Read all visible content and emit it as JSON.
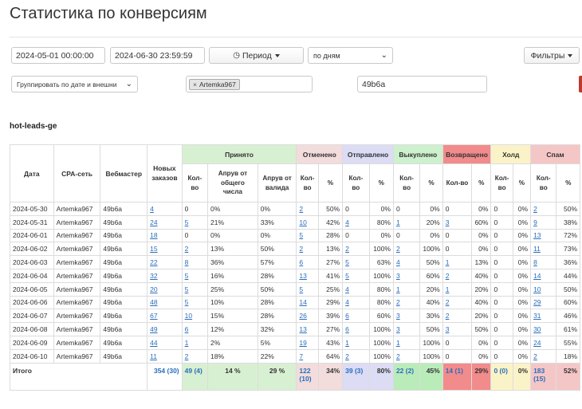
{
  "page": {
    "title": "Статистика по конверсиям"
  },
  "filters": {
    "date_from": "2024-05-01 00:00:00",
    "date_to": "2024-06-30 23:59:59",
    "period_label": "Период",
    "granularity": "по дням",
    "filters_label": "Фильтры",
    "group_by": "Группировать по дате и внешни",
    "selected_tag": "Artemka967",
    "search_value": "49b6a"
  },
  "section": {
    "title": "hot-leads-ge"
  },
  "table": {
    "headers": {
      "date": "Дата",
      "cpa": "CPA-сеть",
      "webmaster": "Вебмастер",
      "new_orders": "Новых заказов",
      "accepted": "Принято",
      "cancelled": "Отменено",
      "sent": "Отправлено",
      "bought": "Выкуплено",
      "returned": "Возвращено",
      "hold": "Холд",
      "spam": "Спам",
      "count": "Кол-во",
      "pct": "%",
      "approve_total": "Апрув от общего числа",
      "approve_valid": "Апрув от валида"
    },
    "rows": [
      [
        "2024-05-30",
        "Artemka967",
        "49b6a",
        "4",
        "0",
        "0%",
        "0%",
        "2",
        "50%",
        "0",
        "0%",
        "0",
        "0%",
        "0",
        "0%",
        "0",
        "0%",
        "2",
        "50%"
      ],
      [
        "2024-05-31",
        "Artemka967",
        "49b6a",
        "24",
        "5",
        "21%",
        "33%",
        "10",
        "42%",
        "4",
        "80%",
        "1",
        "20%",
        "3",
        "60%",
        "0",
        "0%",
        "9",
        "38%"
      ],
      [
        "2024-06-01",
        "Artemka967",
        "49b6a",
        "18",
        "0",
        "0%",
        "0%",
        "5",
        "28%",
        "0",
        "0%",
        "0",
        "0%",
        "0",
        "0%",
        "0",
        "0%",
        "13",
        "72%"
      ],
      [
        "2024-06-02",
        "Artemka967",
        "49b6a",
        "15",
        "2",
        "13%",
        "50%",
        "2",
        "13%",
        "2",
        "100%",
        "2",
        "100%",
        "0",
        "0%",
        "0",
        "0%",
        "11",
        "73%"
      ],
      [
        "2024-06-03",
        "Artemka967",
        "49b6a",
        "22",
        "8",
        "36%",
        "57%",
        "6",
        "27%",
        "5",
        "63%",
        "4",
        "50%",
        "1",
        "13%",
        "0",
        "0%",
        "8",
        "36%"
      ],
      [
        "2024-06-04",
        "Artemka967",
        "49b6a",
        "32",
        "5",
        "16%",
        "28%",
        "13",
        "41%",
        "5",
        "100%",
        "3",
        "60%",
        "2",
        "40%",
        "0",
        "0%",
        "14",
        "44%"
      ],
      [
        "2024-06-05",
        "Artemka967",
        "49b6a",
        "20",
        "5",
        "25%",
        "50%",
        "5",
        "25%",
        "4",
        "80%",
        "1",
        "20%",
        "1",
        "20%",
        "0",
        "0%",
        "10",
        "50%"
      ],
      [
        "2024-06-06",
        "Artemka967",
        "49b6a",
        "48",
        "5",
        "10%",
        "28%",
        "14",
        "29%",
        "4",
        "80%",
        "2",
        "40%",
        "2",
        "40%",
        "0",
        "0%",
        "29",
        "60%"
      ],
      [
        "2024-06-07",
        "Artemka967",
        "49b6a",
        "67",
        "10",
        "15%",
        "28%",
        "26",
        "39%",
        "6",
        "60%",
        "3",
        "30%",
        "2",
        "20%",
        "0",
        "0%",
        "31",
        "46%"
      ],
      [
        "2024-06-08",
        "Artemka967",
        "49b6a",
        "49",
        "6",
        "12%",
        "32%",
        "13",
        "27%",
        "6",
        "100%",
        "3",
        "50%",
        "3",
        "50%",
        "0",
        "0%",
        "30",
        "61%"
      ],
      [
        "2024-06-09",
        "Artemka967",
        "49b6a",
        "44",
        "1",
        "2%",
        "5%",
        "19",
        "43%",
        "1",
        "100%",
        "1",
        "100%",
        "0",
        "0%",
        "0",
        "0%",
        "24",
        "55%"
      ],
      [
        "2024-06-10",
        "Artemka967",
        "49b6a",
        "11",
        "2",
        "18%",
        "22%",
        "7",
        "64%",
        "2",
        "100%",
        "2",
        "100%",
        "0",
        "0%",
        "0",
        "0%",
        "2",
        "18%"
      ]
    ],
    "total": {
      "label": "Итого",
      "new_orders": "354 (30)",
      "accepted": "49 (4)",
      "approve_total": "14 %",
      "approve_valid": "29 %",
      "cancelled": "122 (10)",
      "cancelled_pct": "34%",
      "sent": "39 (3)",
      "sent_pct": "80%",
      "bought": "22 (2)",
      "bought_pct": "45%",
      "returned": "14 (1)",
      "returned_pct": "29%",
      "hold": "0 (0)",
      "hold_pct": "0%",
      "spam": "183 (15)",
      "spam_pct": "52%"
    }
  },
  "colors": {
    "accepted": "#d8f0d2",
    "cancelled": "#f2dcdc",
    "sent": "#dcdcf5",
    "bought": "#cdf0cd",
    "returned": "#f28b8b",
    "hold": "#fbf3c8",
    "spam": "#f5c6c6",
    "link": "#2a6ebb"
  }
}
